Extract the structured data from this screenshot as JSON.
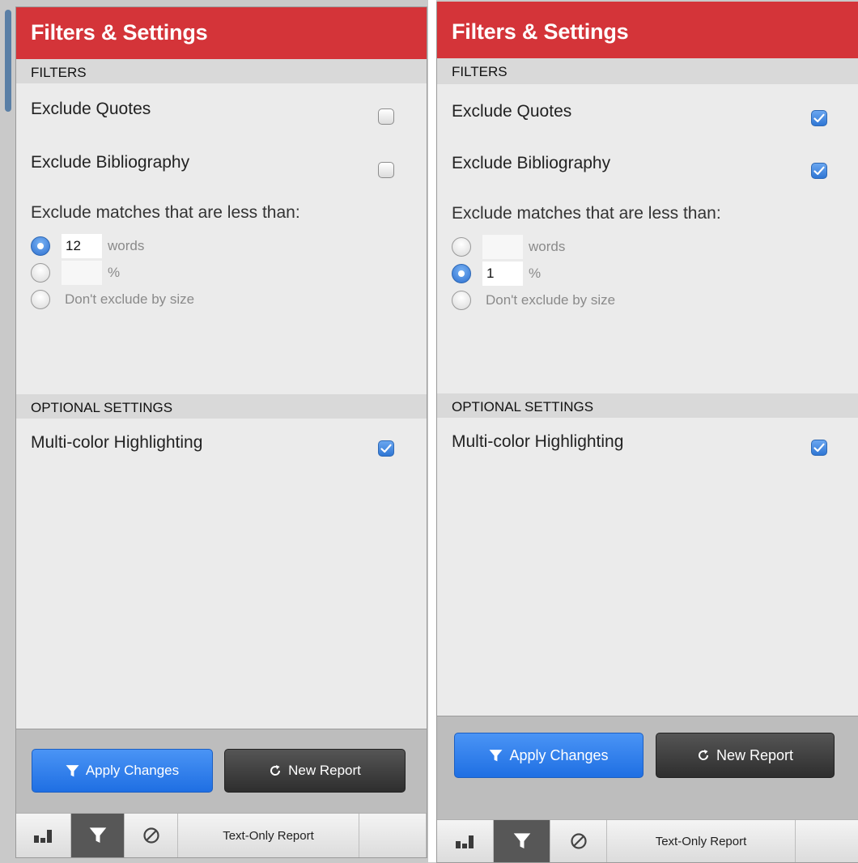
{
  "panels": [
    {
      "title": "Filters & Settings",
      "filters_header": "FILTERS",
      "exclude_quotes": {
        "label": "Exclude Quotes",
        "checked": false
      },
      "exclude_bibliography": {
        "label": "Exclude Bibliography",
        "checked": false
      },
      "size_label": "Exclude matches that are less than:",
      "size_options": [
        {
          "value": "12",
          "unit": "words",
          "selected": true
        },
        {
          "value": "",
          "unit": "%",
          "selected": false
        },
        {
          "label": "Don't exclude by size",
          "selected": false
        }
      ],
      "optional_header": "OPTIONAL SETTINGS",
      "multicolor": {
        "label": "Multi-color Highlighting",
        "checked": true
      },
      "apply_label": "Apply Changes",
      "new_report_label": "New Report",
      "text_only_label": "Text-Only Report"
    },
    {
      "title": "Filters & Settings",
      "filters_header": "FILTERS",
      "exclude_quotes": {
        "label": "Exclude Quotes",
        "checked": true
      },
      "exclude_bibliography": {
        "label": "Exclude Bibliography",
        "checked": true
      },
      "size_label": "Exclude matches that are less than:",
      "size_options": [
        {
          "value": "",
          "unit": "words",
          "selected": false
        },
        {
          "value": "1",
          "unit": "%",
          "selected": true
        },
        {
          "label": "Don't exclude by size",
          "selected": false
        }
      ],
      "optional_header": "OPTIONAL SETTINGS",
      "multicolor": {
        "label": "Multi-color Highlighting",
        "checked": true
      },
      "apply_label": "Apply Changes",
      "new_report_label": "New Report",
      "text_only_label": "Text-Only Report"
    }
  ],
  "colors": {
    "title_bar": "#d43439",
    "apply_button": "#2f7ae8",
    "new_report_button": "#3a3a3a",
    "checkbox_checked": "#3b82dc"
  },
  "icons": {
    "apply": "filter-icon",
    "new_report": "refresh-icon",
    "toolbar": [
      "bar-chart-icon",
      "filter-icon",
      "exclude-icon"
    ]
  }
}
